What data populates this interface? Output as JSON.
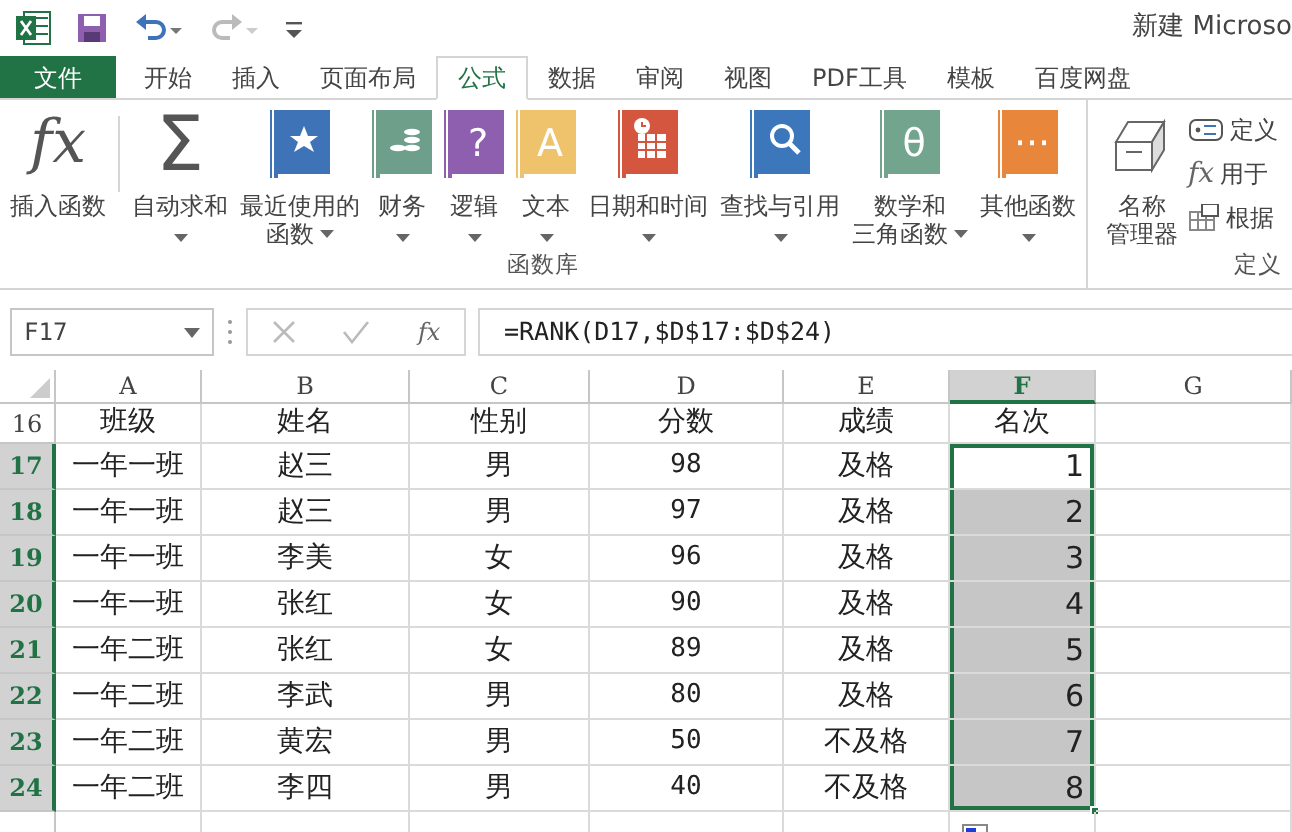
{
  "title": "新建 Microso",
  "tabs": [
    {
      "label": "文件",
      "kind": "file",
      "selected": false
    },
    {
      "label": "开始",
      "kind": "tab",
      "selected": false
    },
    {
      "label": "插入",
      "kind": "tab",
      "selected": false
    },
    {
      "label": "页面布局",
      "kind": "tab",
      "selected": false
    },
    {
      "label": "公式",
      "kind": "tab",
      "selected": true
    },
    {
      "label": "数据",
      "kind": "tab",
      "selected": false
    },
    {
      "label": "审阅",
      "kind": "tab",
      "selected": false
    },
    {
      "label": "视图",
      "kind": "tab",
      "selected": false
    },
    {
      "label": "PDF工具",
      "kind": "tab",
      "selected": false
    },
    {
      "label": "模板",
      "kind": "tab",
      "selected": false
    },
    {
      "label": "百度网盘",
      "kind": "tab",
      "selected": false
    }
  ],
  "ribbon": {
    "groups": [
      {
        "label": "函数库",
        "buttons": [
          {
            "lines": [
              "插入函数"
            ],
            "dropdown": false,
            "icon": {
              "kind": "glyph",
              "glyph": "fx"
            }
          },
          {
            "lines": [
              "自动求和"
            ],
            "dropdown": true,
            "icon": {
              "kind": "glyph",
              "glyph": "Σ"
            }
          },
          {
            "lines": [
              "最近使用的",
              "函数"
            ],
            "dropdown": true,
            "icon": {
              "kind": "star",
              "color": "#3f73b8"
            }
          },
          {
            "lines": [
              "财务"
            ],
            "dropdown": true,
            "icon": {
              "kind": "coins",
              "color": "#6e9f8a"
            }
          },
          {
            "lines": [
              "逻辑"
            ],
            "dropdown": true,
            "icon": {
              "kind": "book",
              "color": "#8e5fae",
              "glyph": "?"
            }
          },
          {
            "lines": [
              "文本"
            ],
            "dropdown": true,
            "icon": {
              "kind": "book",
              "color": "#eec36b",
              "glyph": "A"
            }
          },
          {
            "lines": [
              "日期和时间"
            ],
            "dropdown": true,
            "icon": {
              "kind": "calendar",
              "color": "#d5563f"
            }
          },
          {
            "lines": [
              "查找与引用"
            ],
            "dropdown": true,
            "icon": {
              "kind": "magnifier",
              "color": "#3c77bb"
            }
          },
          {
            "lines": [
              "数学和",
              "三角函数"
            ],
            "dropdown": true,
            "icon": {
              "kind": "book",
              "color": "#72a48e",
              "glyph": "θ"
            }
          },
          {
            "lines": [
              "其他函数"
            ],
            "dropdown": true,
            "icon": {
              "kind": "book",
              "color": "#e8873c",
              "glyph": "···"
            }
          }
        ]
      },
      {
        "label": "定义",
        "buttons": [
          {
            "lines": [
              "名称",
              "管理器"
            ],
            "dropdown": false,
            "icon": {
              "kind": "drawer"
            }
          }
        ],
        "small_items": [
          {
            "label": "定义",
            "kind": "tag"
          },
          {
            "label": "用于",
            "kind": "glyph",
            "glyph": "fx"
          },
          {
            "label": "根据",
            "kind": "table"
          }
        ]
      }
    ]
  },
  "formula_bar": {
    "name_box": "F17",
    "fx": "fx",
    "formula": "=RANK(D17,$D$17:$D$24)"
  },
  "sheet": {
    "columns": [
      {
        "label": "A",
        "selected": false
      },
      {
        "label": "B",
        "selected": false
      },
      {
        "label": "C",
        "selected": false
      },
      {
        "label": "D",
        "selected": false
      },
      {
        "label": "E",
        "selected": false
      },
      {
        "label": "F",
        "selected": true
      },
      {
        "label": "G",
        "selected": false
      }
    ],
    "rows": [
      {
        "number": "16",
        "selected": false,
        "shaded": false,
        "cells": [
          "班级",
          "姓名",
          "性别",
          "分数",
          "成绩",
          "名次"
        ]
      },
      {
        "number": "17",
        "selected": true,
        "shaded": false,
        "cells": [
          "一年一班",
          "赵三",
          "男",
          "98",
          "及格",
          "1"
        ]
      },
      {
        "number": "18",
        "selected": true,
        "shaded": true,
        "cells": [
          "一年一班",
          "赵三",
          "男",
          "97",
          "及格",
          "2"
        ]
      },
      {
        "number": "19",
        "selected": true,
        "shaded": true,
        "cells": [
          "一年一班",
          "李美",
          "女",
          "96",
          "及格",
          "3"
        ]
      },
      {
        "number": "20",
        "selected": true,
        "shaded": true,
        "cells": [
          "一年一班",
          "张红",
          "女",
          "90",
          "及格",
          "4"
        ]
      },
      {
        "number": "21",
        "selected": true,
        "shaded": true,
        "cells": [
          "一年二班",
          "张红",
          "女",
          "89",
          "及格",
          "5"
        ]
      },
      {
        "number": "22",
        "selected": true,
        "shaded": true,
        "cells": [
          "一年二班",
          "李武",
          "男",
          "80",
          "及格",
          "6"
        ]
      },
      {
        "number": "23",
        "selected": true,
        "shaded": true,
        "cells": [
          "一年二班",
          "黄宏",
          "男",
          "50",
          "不及格",
          "7"
        ]
      },
      {
        "number": "24",
        "selected": true,
        "shaded": true,
        "cells": [
          "一年二班",
          "李四",
          "男",
          "40",
          "不及格",
          "8"
        ]
      }
    ]
  }
}
